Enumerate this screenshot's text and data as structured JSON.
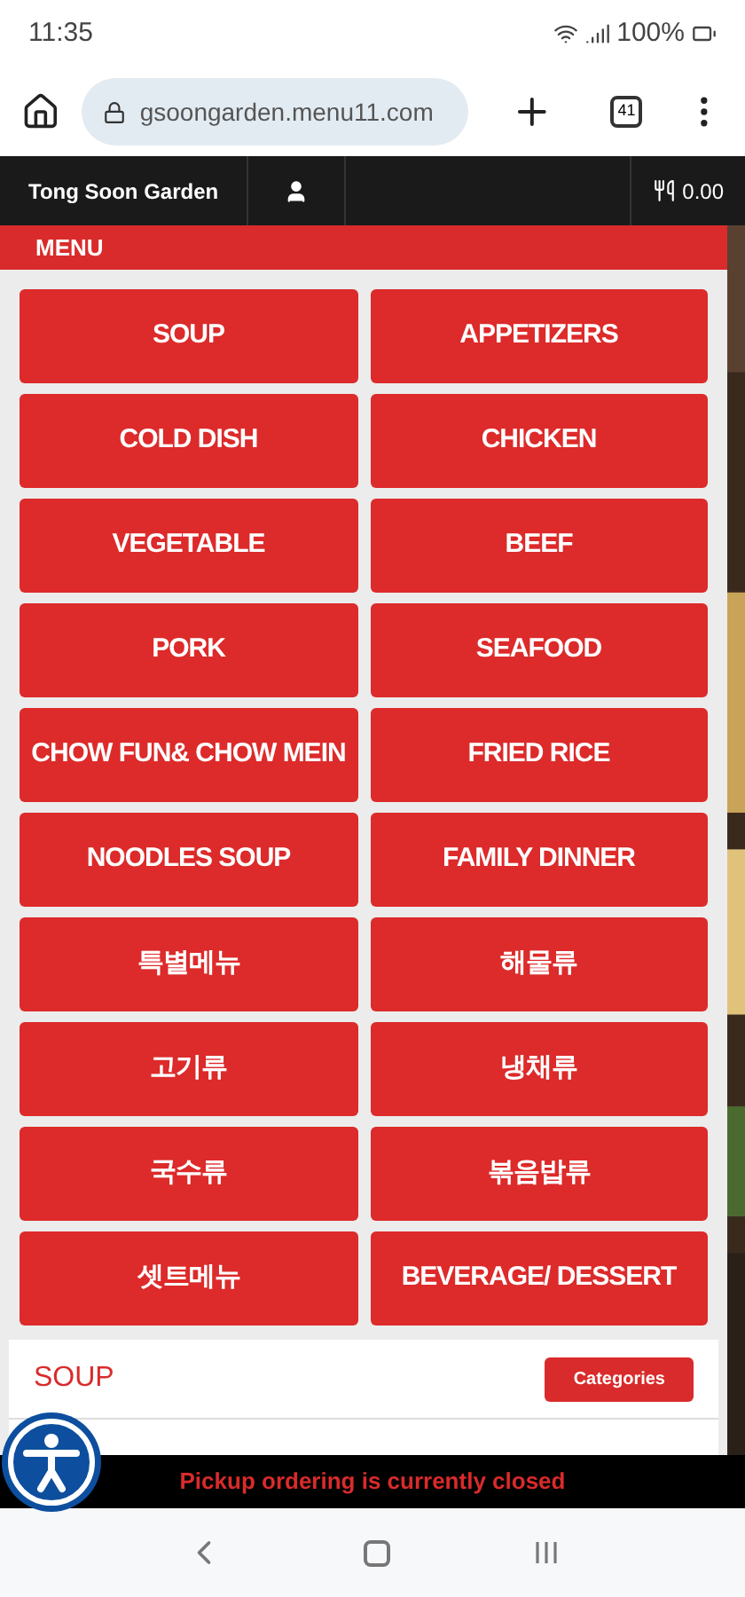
{
  "status_bar": {
    "time": "11:35",
    "battery": "100%"
  },
  "browser": {
    "url": "gsoongarden.menu11.com",
    "tab_count": "41"
  },
  "nav": {
    "title": "Tong Soon Garden",
    "cart_total": "0.00"
  },
  "menu_header": "MENU",
  "categories": [
    "SOUP",
    "APPETIZERS",
    "COLD DISH",
    "CHICKEN",
    "VEGETABLE",
    "BEEF",
    "PORK",
    "SEAFOOD",
    "CHOW FUN& CHOW MEIN",
    "FRIED RICE",
    "NOODLES SOUP",
    "FAMILY DINNER",
    "특별메뉴",
    "해물류",
    "고기류",
    "냉채류",
    "국수류",
    "볶음밥류",
    "셋트메뉴",
    "BEVERAGE/ DESSERT"
  ],
  "section": {
    "title": "SOUP",
    "button": "Categories"
  },
  "notice": "Pickup ordering is currently closed"
}
